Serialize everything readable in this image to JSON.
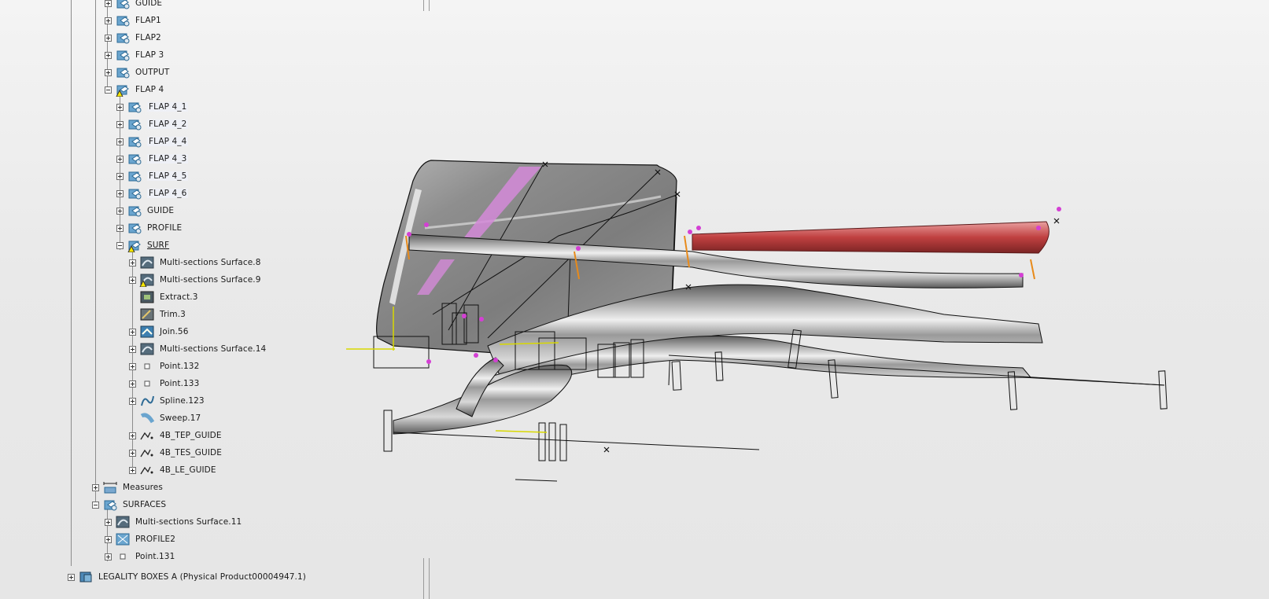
{
  "tree": {
    "items": [
      {
        "label": "GUIDE",
        "depth": 2,
        "toggle": "plus",
        "icon": "geometrical-set-icon"
      },
      {
        "label": "FLAP1",
        "depth": 2,
        "toggle": "plus",
        "icon": "geometrical-set-icon"
      },
      {
        "label": "FLAP2",
        "depth": 2,
        "toggle": "plus",
        "icon": "geometrical-set-icon"
      },
      {
        "label": "FLAP 3",
        "depth": 2,
        "toggle": "plus",
        "icon": "geometrical-set-icon"
      },
      {
        "label": "OUTPUT",
        "depth": 2,
        "toggle": "plus",
        "icon": "geometrical-set-icon"
      },
      {
        "label": "FLAP 4",
        "depth": 2,
        "toggle": "minus",
        "icon": "geometrical-set-warning-icon"
      },
      {
        "label": "FLAP 4_1",
        "depth": 3,
        "toggle": "plus",
        "icon": "geometrical-set-icon",
        "hl": true
      },
      {
        "label": "FLAP 4_2",
        "depth": 3,
        "toggle": "plus",
        "icon": "geometrical-set-icon",
        "hl": true
      },
      {
        "label": "FLAP 4_4",
        "depth": 3,
        "toggle": "plus",
        "icon": "geometrical-set-icon",
        "hl": true
      },
      {
        "label": "FLAP 4_3",
        "depth": 3,
        "toggle": "plus",
        "icon": "geometrical-set-icon",
        "hl": true
      },
      {
        "label": "FLAP 4_5",
        "depth": 3,
        "toggle": "plus",
        "icon": "geometrical-set-icon",
        "hl": true
      },
      {
        "label": "FLAP 4_6",
        "depth": 3,
        "toggle": "plus",
        "icon": "geometrical-set-icon",
        "hl": true
      },
      {
        "label": "GUIDE",
        "depth": 3,
        "toggle": "plus",
        "icon": "geometrical-set-icon"
      },
      {
        "label": "PROFILE",
        "depth": 3,
        "toggle": "plus",
        "icon": "geometrical-set-icon"
      },
      {
        "label": "SURF",
        "depth": 3,
        "toggle": "minus",
        "icon": "geometrical-set-warning-icon",
        "underline": true
      },
      {
        "label": "Multi-sections Surface.8",
        "depth": 4,
        "toggle": "plus",
        "icon": "multi-sections-surface-icon"
      },
      {
        "label": "Multi-sections Surface.9",
        "depth": 4,
        "toggle": "plus",
        "icon": "multi-sections-surface-warning-icon"
      },
      {
        "label": "Extract.3",
        "depth": 4,
        "toggle": "none",
        "icon": "extract-icon"
      },
      {
        "label": "Trim.3",
        "depth": 4,
        "toggle": "none",
        "icon": "trim-icon"
      },
      {
        "label": "Join.56",
        "depth": 4,
        "toggle": "plus",
        "icon": "join-icon"
      },
      {
        "label": "Multi-sections Surface.14",
        "depth": 4,
        "toggle": "plus",
        "icon": "multi-sections-surface-icon"
      },
      {
        "label": "Point.132",
        "depth": 4,
        "toggle": "plus",
        "icon": "point-icon"
      },
      {
        "label": "Point.133",
        "depth": 4,
        "toggle": "plus",
        "icon": "point-icon"
      },
      {
        "label": "Spline.123",
        "depth": 4,
        "toggle": "plus",
        "icon": "spline-icon"
      },
      {
        "label": "Sweep.17",
        "depth": 4,
        "toggle": "none",
        "icon": "sweep-icon"
      },
      {
        "label": "4B_TEP_GUIDE",
        "depth": 4,
        "toggle": "plus",
        "icon": "curve-icon"
      },
      {
        "label": "4B_TES_GUIDE",
        "depth": 4,
        "toggle": "plus",
        "icon": "curve-icon"
      },
      {
        "label": "4B_LE_GUIDE",
        "depth": 4,
        "toggle": "plus",
        "icon": "curve-icon"
      },
      {
        "label": "Measures",
        "depth": 1,
        "toggle": "plus",
        "icon": "measures-icon"
      },
      {
        "label": "SURFACES",
        "depth": 1,
        "toggle": "minus",
        "icon": "geometrical-set-icon"
      },
      {
        "label": "Multi-sections Surface.11",
        "depth": 2,
        "toggle": "plus",
        "icon": "multi-sections-surface-icon"
      },
      {
        "label": "PROFILE2",
        "depth": 2,
        "toggle": "plus",
        "icon": "sketch-icon"
      },
      {
        "label": "Point.131",
        "depth": 2,
        "toggle": "plus",
        "icon": "point-icon"
      },
      {
        "label": "LEGALITY BOXES A (Physical Product00004947.1)",
        "depth": 0,
        "toggle": "plus",
        "icon": "product-icon"
      }
    ]
  },
  "viewport": {
    "colors": {
      "surface": "#8f8f8f",
      "highlight": "#f7f7f7",
      "red": "#c94b4b",
      "pink": "#d48ad8",
      "axis": "#d8d800",
      "edge": "#111111"
    }
  }
}
